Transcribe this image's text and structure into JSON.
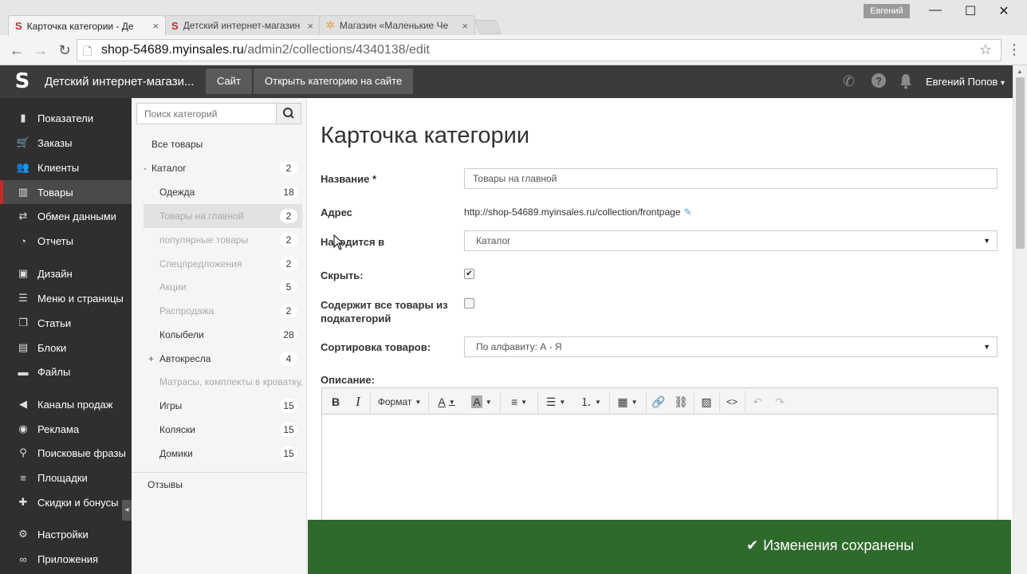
{
  "browser": {
    "tabs": [
      {
        "title": "Карточка категории - Де",
        "active": true
      },
      {
        "title": "Детский интернет-магазин",
        "active": false
      },
      {
        "title": "Магазин «Маленькие Че",
        "active": false
      }
    ],
    "profile": "Евгений",
    "url_host": "shop-54689.myinsales.ru",
    "url_path": "/admin2/collections/4340138/edit"
  },
  "appbar": {
    "logo": "S",
    "store_name": "Детский интернет-магази...",
    "site_button": "Сайт",
    "open_category_button": "Открыть категорию на сайте",
    "user_name": "Евгений Попов"
  },
  "sidebar": {
    "items": [
      {
        "label": "Показатели",
        "icon": "bar-chart-icon"
      },
      {
        "label": "Заказы",
        "icon": "cart-icon"
      },
      {
        "label": "Клиенты",
        "icon": "users-icon"
      },
      {
        "label": "Товары",
        "icon": "tag-icon",
        "active": true
      },
      {
        "label": "Обмен данными",
        "icon": "exchange-icon"
      },
      {
        "label": "Отчеты",
        "icon": "report-icon"
      },
      {
        "label": "Дизайн",
        "icon": "image-icon"
      },
      {
        "label": "Меню и страницы",
        "icon": "menu-icon"
      },
      {
        "label": "Статьи",
        "icon": "articles-icon"
      },
      {
        "label": "Блоки",
        "icon": "blocks-icon"
      },
      {
        "label": "Файлы",
        "icon": "folder-icon"
      },
      {
        "label": "Каналы продаж",
        "icon": "channel-icon"
      },
      {
        "label": "Реклама",
        "icon": "ad-icon"
      },
      {
        "label": "Поисковые фразы",
        "icon": "search-icon"
      },
      {
        "label": "Площадки",
        "icon": "list-icon"
      },
      {
        "label": "Скидки и бонусы",
        "icon": "gift-icon"
      },
      {
        "label": "Настройки",
        "icon": "gear-icon"
      },
      {
        "label": "Приложения",
        "icon": "link-icon"
      }
    ]
  },
  "categories": {
    "search_placeholder": "Поиск категорий",
    "all_products": "Все товары",
    "catalog": {
      "label": "Каталог",
      "count": "2",
      "toggle": "-"
    },
    "items": [
      {
        "label": "Одежда",
        "count": "18"
      },
      {
        "label": "Товары на главной",
        "count": "2"
      },
      {
        "label": "популярные товары",
        "count": "2"
      },
      {
        "label": "Спецпредложения",
        "count": "2"
      },
      {
        "label": "Акции",
        "count": "5"
      },
      {
        "label": "Распродажа",
        "count": "2"
      },
      {
        "label": "Колыбели",
        "count": "28"
      },
      {
        "label": "Автокресла",
        "count": "4",
        "toggle": "+"
      },
      {
        "label": "Матрасы, комплекты в кроватку,",
        "count": ""
      },
      {
        "label": "Игры",
        "count": "15"
      },
      {
        "label": "Коляски",
        "count": "15"
      },
      {
        "label": "Домики",
        "count": "15"
      }
    ],
    "reviews": "Отзывы"
  },
  "form": {
    "title": "Карточка категории",
    "name_label": "Название *",
    "name_value": "Товары на главной",
    "address_label": "Адрес",
    "address_value": "http://shop-54689.myinsales.ru/collection/frontpage",
    "parent_label": "Находится в",
    "parent_value": "Каталог",
    "hide_label": "Скрыть:",
    "hide_checked": true,
    "subcats_label_1": "Содержит все товары из",
    "subcats_label_2": "подкатегорий",
    "subcats_checked": false,
    "sort_label": "Сортировка товаров:",
    "sort_value": "По алфавиту: А - Я",
    "description_label": "Описание:",
    "toolbar_format": "Формат"
  },
  "toast": {
    "message": "Изменения сохранены",
    "color": "#2e6b2b"
  },
  "colors": {
    "accent": "#c62828",
    "sidebar_bg": "#2f2f2f",
    "appbar_bg": "#3b3b3b"
  }
}
